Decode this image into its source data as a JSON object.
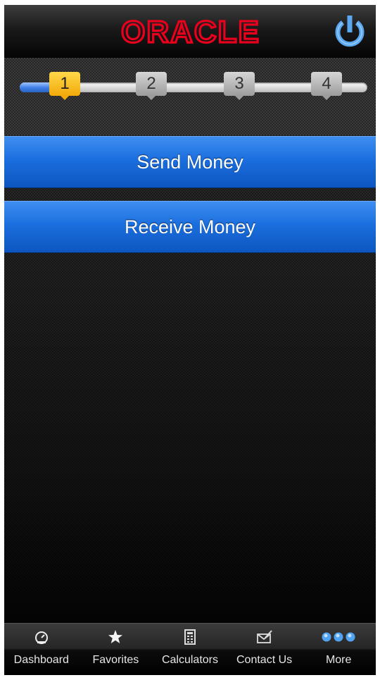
{
  "header": {
    "logo_text": "ORACLE",
    "logo_color": "#e8001c",
    "power_icon": "power-icon",
    "power_color": "#5aa9f0"
  },
  "stepper": {
    "current_step": 1,
    "steps": [
      "1",
      "2",
      "3",
      "4"
    ],
    "active_color": "#f5b61a",
    "track_fill_color": "#3d7ee6"
  },
  "actions": {
    "send_label": "Send Money",
    "receive_label": "Receive Money",
    "button_color": "#1b6ede"
  },
  "tabbar": {
    "tabs": [
      {
        "label": "Dashboard",
        "icon": "gauge-icon"
      },
      {
        "label": "Favorites",
        "icon": "star-icon"
      },
      {
        "label": "Calculators",
        "icon": "calculator-icon"
      },
      {
        "label": "Contact Us",
        "icon": "mail-icon"
      },
      {
        "label": "More",
        "icon": "more-dots-icon"
      }
    ]
  }
}
